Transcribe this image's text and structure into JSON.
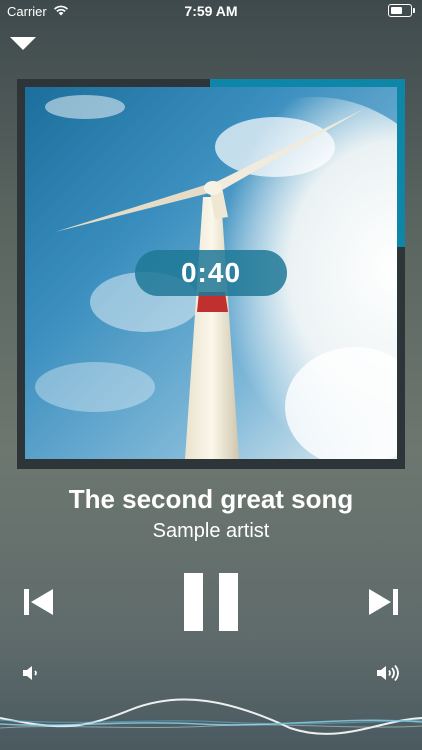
{
  "status": {
    "carrier": "Carrier",
    "time": "7:59 AM"
  },
  "player": {
    "elapsed": "0:40",
    "progress": 0.15,
    "title": "The second great song",
    "artist": "Sample artist"
  },
  "icons": {
    "dismiss": "chevron-down-icon",
    "previous": "skip-previous-icon",
    "pause": "pause-icon",
    "next": "skip-next-icon",
    "volume_low": "volume-low-icon",
    "volume_high": "volume-high-icon"
  },
  "colors": {
    "accent": "#0e86a8",
    "pill": "#1e7896"
  }
}
